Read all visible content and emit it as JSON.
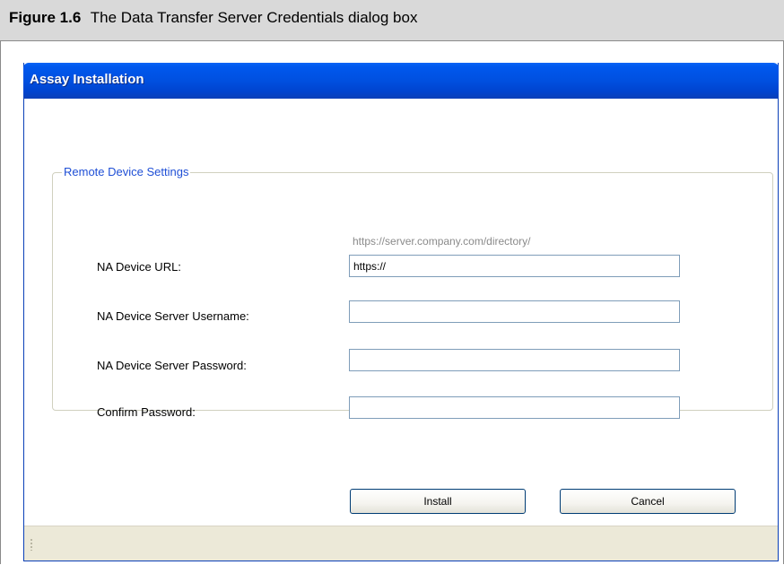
{
  "figure": {
    "number": "Figure 1.6",
    "caption": "The Data Transfer Server Credentials dialog box"
  },
  "window": {
    "title": "Assay Installation"
  },
  "group": {
    "legend": "Remote Device Settings"
  },
  "url_hint": "https://server.company.com/directory/",
  "fields": [
    {
      "label": "NA Device URL:",
      "value": "https://",
      "placeholder": ""
    },
    {
      "label": "NA Device Server Username:",
      "value": "",
      "placeholder": ""
    },
    {
      "label": "NA Device Server Password:",
      "value": "",
      "placeholder": ""
    },
    {
      "label": "Confirm Password:",
      "value": "",
      "placeholder": ""
    }
  ],
  "buttons": {
    "install": "Install",
    "cancel": "Cancel"
  },
  "colors": {
    "titlebar": "#0050e0",
    "legend_text": "#1f4fd6",
    "caption_bg": "#d9d9d9",
    "statusbar_bg": "#ece9d8"
  }
}
